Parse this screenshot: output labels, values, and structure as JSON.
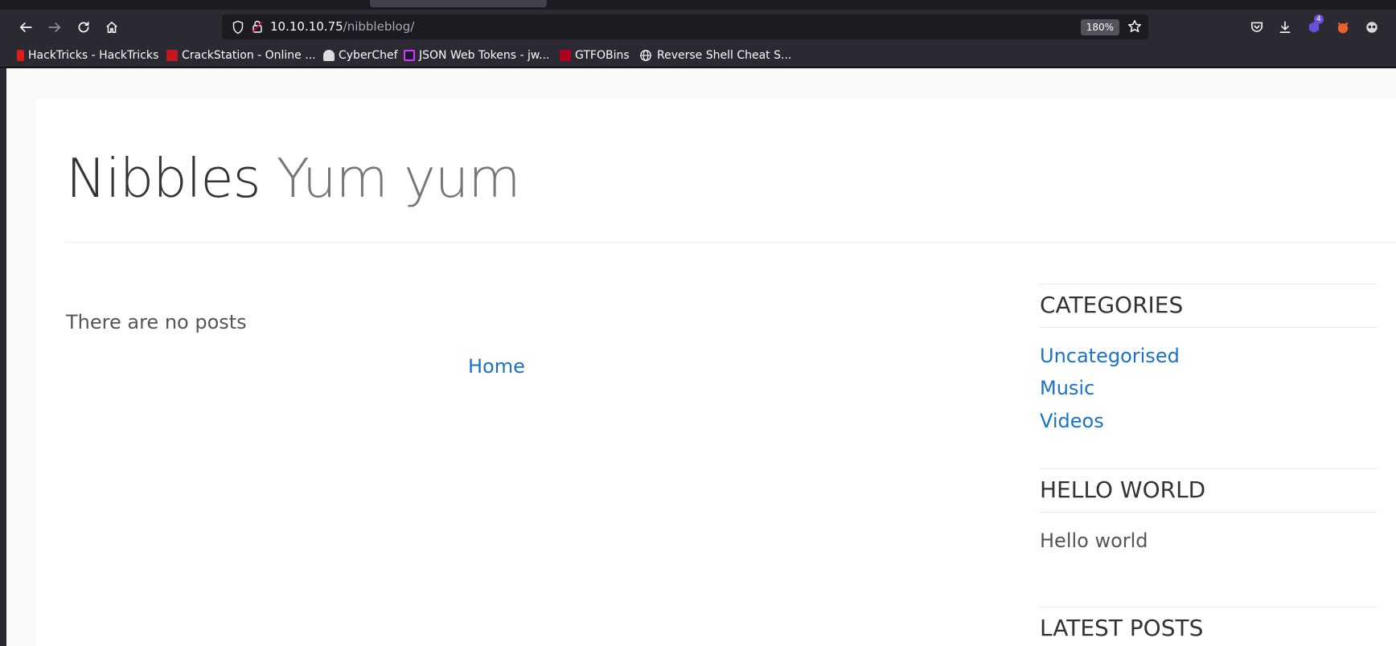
{
  "browser": {
    "url_host": "10.10.10.75",
    "url_path": "/nibbleblog/",
    "zoom": "180%",
    "extension_badge": "4"
  },
  "bookmarks": [
    {
      "label": "HackTricks - HackTricks",
      "color": "#e01b1b"
    },
    {
      "label": "CrackStation - Online ...",
      "color": "#c4161c"
    },
    {
      "label": "CyberChef",
      "color": "#dddddd"
    },
    {
      "label": "JSON Web Tokens - jw...",
      "color": "#d63aff"
    },
    {
      "label": "GTFOBins",
      "color": "#b00020"
    },
    {
      "label": "Reverse Shell Cheat S...",
      "color": "#fbfbfe"
    }
  ],
  "site": {
    "name": "Nibbles",
    "slogan": "Yum yum"
  },
  "main": {
    "no_posts": "There are no posts",
    "home_link": "Home"
  },
  "sidebar": {
    "categories_title": "CATEGORIES",
    "categories": [
      "Uncategorised",
      "Music",
      "Videos"
    ],
    "hello_title": "HELLO WORLD",
    "hello_text": "Hello world",
    "latest_title": "LATEST POSTS"
  },
  "colors": {
    "link": "#1a73c9",
    "chrome": "#2b2a33",
    "accent": "#e0003a"
  }
}
